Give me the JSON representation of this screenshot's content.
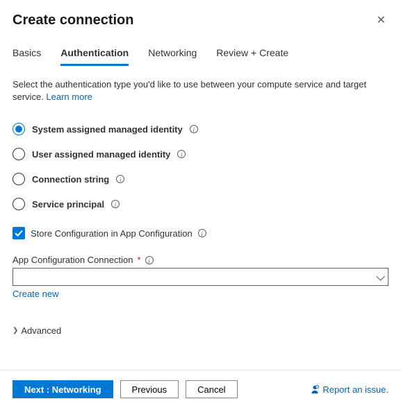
{
  "header": {
    "title": "Create connection"
  },
  "tabs": [
    {
      "label": "Basics",
      "active": false
    },
    {
      "label": "Authentication",
      "active": true
    },
    {
      "label": "Networking",
      "active": false
    },
    {
      "label": "Review + Create",
      "active": false
    }
  ],
  "description": {
    "text": "Select the authentication type you'd like to use between your compute service and target service. ",
    "link": "Learn more"
  },
  "auth_options": [
    {
      "label": "System assigned managed identity",
      "selected": true
    },
    {
      "label": "User assigned managed identity",
      "selected": false
    },
    {
      "label": "Connection string",
      "selected": false
    },
    {
      "label": "Service principal",
      "selected": false
    }
  ],
  "store_config": {
    "label": "Store Configuration in App Configuration",
    "checked": true
  },
  "app_config_field": {
    "label": "App Configuration Connection",
    "required_mark": "*",
    "value": "",
    "create_new": "Create new"
  },
  "advanced": {
    "label": "Advanced"
  },
  "footer": {
    "next": "Next : Networking",
    "previous": "Previous",
    "cancel": "Cancel",
    "report": "Report an issue."
  }
}
